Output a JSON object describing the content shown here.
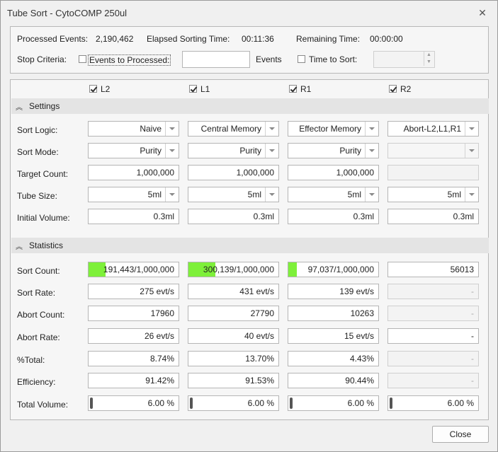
{
  "window": {
    "title": "Tube Sort - CytoCOMP 250ul"
  },
  "header": {
    "processed_label": "Processed Events:",
    "processed_value": "2,190,462",
    "elapsed_label": "Elapsed Sorting Time:",
    "elapsed_value": "00:11:36",
    "remaining_label": "Remaining Time:",
    "remaining_value": "00:00:00",
    "stop_label": "Stop Criteria:",
    "events_cb_label": "Events to Processed:",
    "events_value": "",
    "events_unit": "Events",
    "time_cb_label": "Time to Sort:",
    "time_value": ""
  },
  "columns": [
    {
      "name": "L2",
      "checked": true
    },
    {
      "name": "L1",
      "checked": true
    },
    {
      "name": "R1",
      "checked": true
    },
    {
      "name": "R2",
      "checked": true
    }
  ],
  "settings": {
    "title": "Settings",
    "labels": {
      "sort_logic": "Sort Logic:",
      "sort_mode": "Sort Mode:",
      "target_count": "Target Count:",
      "tube_size": "Tube Size:",
      "initial_volume": "Initial Volume:"
    },
    "sort_logic": [
      "Naive",
      "Central Memory",
      "Effector Memory",
      "Abort-L2,L1,R1"
    ],
    "sort_mode": [
      "Purity",
      "Purity",
      "Purity",
      ""
    ],
    "target_count": [
      "1,000,000",
      "1,000,000",
      "1,000,000",
      ""
    ],
    "tube_size": [
      "5ml",
      "5ml",
      "5ml",
      "5ml"
    ],
    "initial_volume": [
      "0.3ml",
      "0.3ml",
      "0.3ml",
      "0.3ml"
    ]
  },
  "statistics": {
    "title": "Statistics",
    "labels": {
      "sort_count": "Sort Count:",
      "sort_rate": "Sort Rate:",
      "abort_count": "Abort Count:",
      "abort_rate": "Abort Rate:",
      "pct_total": "%Total:",
      "efficiency": "Efficiency:",
      "total_volume": "Total Volume:"
    },
    "sort_count": [
      "191,443/1,000,000",
      "300,139/1,000,000",
      "97,037/1,000,000",
      "56013"
    ],
    "sort_count_progress": [
      0.191,
      0.3,
      0.097
    ],
    "sort_rate": [
      "275 evt/s",
      "431 evt/s",
      "139 evt/s",
      "-"
    ],
    "abort_count": [
      "17960",
      "27790",
      "10263",
      "-"
    ],
    "abort_rate": [
      "26 evt/s",
      "40 evt/s",
      "15 evt/s",
      "-"
    ],
    "pct_total": [
      "8.74%",
      "13.70%",
      "4.43%",
      "-"
    ],
    "efficiency": [
      "91.42%",
      "91.53%",
      "90.44%",
      "-"
    ],
    "total_volume": [
      "6.00 %",
      "6.00 %",
      "6.00 %",
      "6.00 %"
    ]
  },
  "footer": {
    "close_label": "Close"
  },
  "colors": {
    "progress": "#7ef03a",
    "section_bg": "#e4e4e4"
  }
}
